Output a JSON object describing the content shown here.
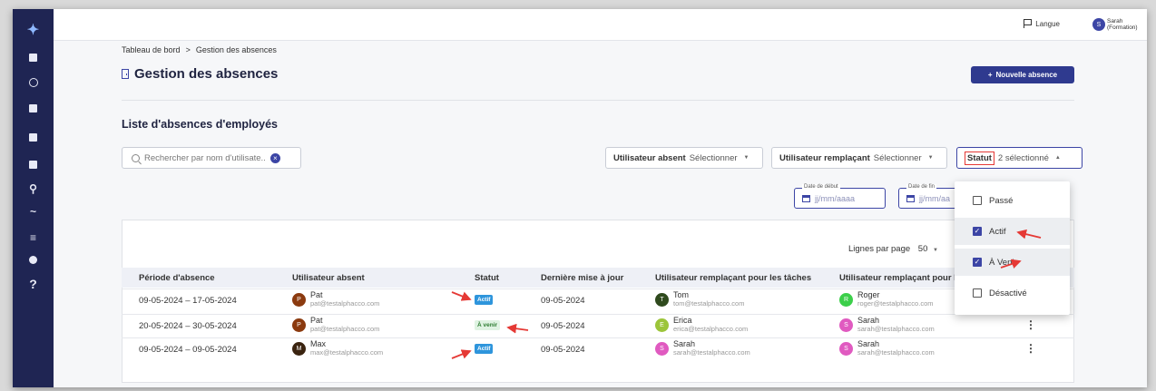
{
  "topbar": {
    "lang_label": "Langue",
    "avatar_initial": "S",
    "user_name": "Sarah (Formation)"
  },
  "breadcrumb": {
    "home": "Tableau de bord",
    "sep": ">",
    "current": "Gestion des absences"
  },
  "page": {
    "title": "Gestion des absences",
    "new_button": "Nouvelle absence",
    "new_button_icon": "+"
  },
  "list": {
    "title": "Liste d'absences d'employés"
  },
  "search": {
    "placeholder": "Rechercher par nom d'utilisate.."
  },
  "filters": {
    "absent": {
      "label": "Utilisateur absent",
      "value": "Sélectionner"
    },
    "replacement": {
      "label": "Utilisateur remplaçant",
      "value": "Sélectionner"
    },
    "status": {
      "label": "Statut",
      "value": "2 sélectionné"
    },
    "start_date": {
      "label": "Date de début",
      "placeholder": "jj/mm/aaaa"
    },
    "end_date": {
      "label": "Date de fin",
      "placeholder": "jj/mm/aa"
    }
  },
  "pager": {
    "label": "Lignes par page",
    "value": "50"
  },
  "table": {
    "headers": [
      "Période d'absence",
      "Utilisateur absent",
      "Statut",
      "Dernière mise à jour",
      "Utilisateur remplaçant pour les tâches",
      "Utilisateur remplaçant pour le"
    ],
    "rows": [
      {
        "period": "09-05-2024 – 17-05-2024",
        "absent": {
          "initial": "P",
          "name": "Pat",
          "email": "pat@testalphacco.com",
          "color": "#8b3a0f"
        },
        "status": "Actif",
        "status_color": "#2e95dc",
        "updated": "09-05-2024",
        "task": {
          "initial": "T",
          "name": "Tom",
          "email": "tom@testalphacco.com",
          "color": "#2f4a1d"
        },
        "other": {
          "initial": "R",
          "name": "Roger",
          "email": "roger@testalphacco.com",
          "color": "#3ccf4a"
        }
      },
      {
        "period": "20-05-2024 – 30-05-2024",
        "absent": {
          "initial": "P",
          "name": "Pat",
          "email": "pat@testalphacco.com",
          "color": "#8b3a0f"
        },
        "status": "À venir",
        "status_color": "#2e7d32",
        "updated": "09-05-2024",
        "task": {
          "initial": "E",
          "name": "Erica",
          "email": "erica@testalphacco.com",
          "color": "#9cc53a"
        },
        "other": {
          "initial": "S",
          "name": "Sarah",
          "email": "sarah@testalphacco.com",
          "color": "#e05ac0"
        }
      },
      {
        "period": "09-05-2024 – 09-05-2024",
        "absent": {
          "initial": "M",
          "name": "Max",
          "email": "max@testalphacco.com",
          "color": "#3b2410"
        },
        "status": "Actif",
        "status_color": "#2e95dc",
        "updated": "09-05-2024",
        "task": {
          "initial": "S",
          "name": "Sarah",
          "email": "sarah@testalphacco.com",
          "color": "#e05ac0"
        },
        "other": {
          "initial": "S",
          "name": "Sarah",
          "email": "sarah@testalphacco.com",
          "color": "#e05ac0"
        }
      }
    ]
  },
  "status_options": [
    {
      "label": "Passé",
      "checked": false
    },
    {
      "label": "Actif",
      "checked": true
    },
    {
      "label": "À Venir",
      "checked": true
    },
    {
      "label": "Désactivé",
      "checked": false
    }
  ],
  "colors": {
    "sidebar": "#1f2553",
    "accent": "#2f3a8f",
    "annotation": "#e53935"
  }
}
